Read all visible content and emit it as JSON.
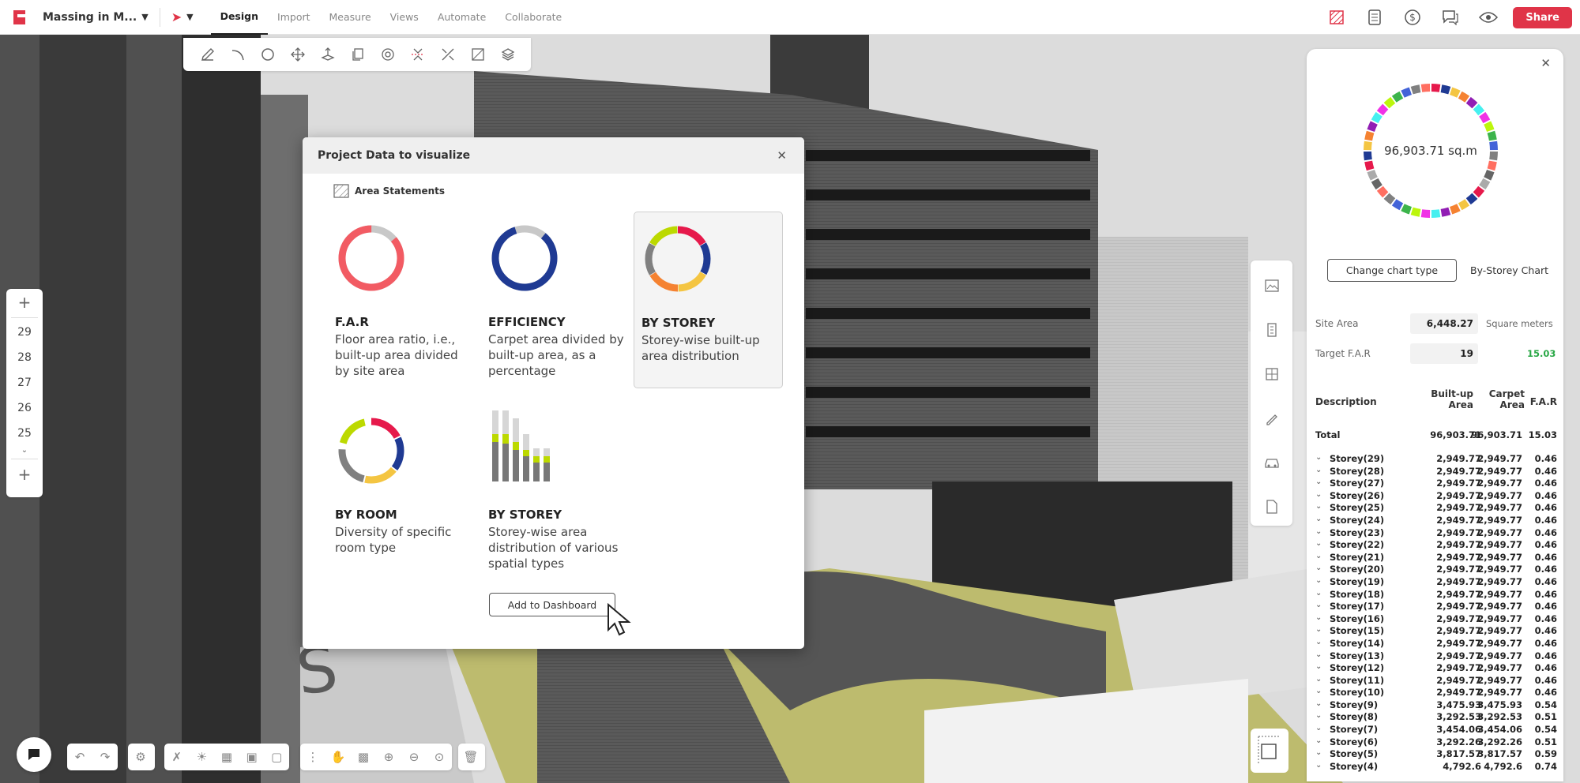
{
  "header": {
    "project_name": "Massing in M...",
    "tabs": [
      {
        "label": "Design",
        "active": true
      },
      {
        "label": "Import"
      },
      {
        "label": "Measure"
      },
      {
        "label": "Views"
      },
      {
        "label": "Automate"
      },
      {
        "label": "Collaborate"
      }
    ],
    "share_label": "Share",
    "icons": [
      "area-plan-icon",
      "calculator-icon",
      "dollar-icon",
      "comment-icon",
      "eye-icon"
    ]
  },
  "toolbar_icons": [
    "pencil-icon",
    "arc-icon",
    "circle-icon",
    "move-icon",
    "extrude-icon",
    "copy-icon",
    "rotate-icon",
    "split-icon",
    "trim-icon",
    "boolean-icon",
    "layers-icon"
  ],
  "storeys": [
    "29",
    "28",
    "27",
    "26",
    "25"
  ],
  "modal": {
    "title": "Project Data to visualize",
    "section": "Area Statements",
    "cards": [
      {
        "title": "F.A.R",
        "desc": "Floor area ratio, i.e., built-up area divided by site area"
      },
      {
        "title": "EFFICIENCY",
        "desc": "Carpet area divided by built-up area, as a percentage"
      },
      {
        "title": "BY STOREY",
        "desc": "Storey-wise built-up area distribution"
      },
      {
        "title": "BY ROOM",
        "desc": "Diversity of specific room type"
      },
      {
        "title": "BY STOREY",
        "desc": "Storey-wise area distribution of various spatial types"
      }
    ],
    "add_label": "Add to Dashboard"
  },
  "panel": {
    "total_label": "96,903.71 sq.m",
    "change_chart": "Change chart type",
    "chart_name": "By-Storey Chart",
    "site_area_label": "Site Area",
    "site_area_value": "6,448.27",
    "site_area_unit": "Square meters",
    "target_far_label": "Target F.A.R",
    "target_far_value": "19",
    "target_far_actual": "15.03",
    "col_desc": "Description",
    "col_built": "Built-up Area",
    "col_carpet": "Carpet Area",
    "col_far": "F.A.R",
    "total": {
      "label": "Total",
      "built": "96,903.71",
      "carpet": "96,903.71",
      "far": "15.03"
    },
    "rows": [
      {
        "label": "Storey(29)",
        "built": "2,949.77",
        "carpet": "2,949.77",
        "far": "0.46"
      },
      {
        "label": "Storey(28)",
        "built": "2,949.77",
        "carpet": "2,949.77",
        "far": "0.46"
      },
      {
        "label": "Storey(27)",
        "built": "2,949.77",
        "carpet": "2,949.77",
        "far": "0.46"
      },
      {
        "label": "Storey(26)",
        "built": "2,949.77",
        "carpet": "2,949.77",
        "far": "0.46"
      },
      {
        "label": "Storey(25)",
        "built": "2,949.77",
        "carpet": "2,949.77",
        "far": "0.46"
      },
      {
        "label": "Storey(24)",
        "built": "2,949.77",
        "carpet": "2,949.77",
        "far": "0.46"
      },
      {
        "label": "Storey(23)",
        "built": "2,949.77",
        "carpet": "2,949.77",
        "far": "0.46"
      },
      {
        "label": "Storey(22)",
        "built": "2,949.77",
        "carpet": "2,949.77",
        "far": "0.46"
      },
      {
        "label": "Storey(21)",
        "built": "2,949.77",
        "carpet": "2,949.77",
        "far": "0.46"
      },
      {
        "label": "Storey(20)",
        "built": "2,949.77",
        "carpet": "2,949.77",
        "far": "0.46"
      },
      {
        "label": "Storey(19)",
        "built": "2,949.77",
        "carpet": "2,949.77",
        "far": "0.46"
      },
      {
        "label": "Storey(18)",
        "built": "2,949.77",
        "carpet": "2,949.77",
        "far": "0.46"
      },
      {
        "label": "Storey(17)",
        "built": "2,949.77",
        "carpet": "2,949.77",
        "far": "0.46"
      },
      {
        "label": "Storey(16)",
        "built": "2,949.77",
        "carpet": "2,949.77",
        "far": "0.46"
      },
      {
        "label": "Storey(15)",
        "built": "2,949.77",
        "carpet": "2,949.77",
        "far": "0.46"
      },
      {
        "label": "Storey(14)",
        "built": "2,949.77",
        "carpet": "2,949.77",
        "far": "0.46"
      },
      {
        "label": "Storey(13)",
        "built": "2,949.77",
        "carpet": "2,949.77",
        "far": "0.46"
      },
      {
        "label": "Storey(12)",
        "built": "2,949.77",
        "carpet": "2,949.77",
        "far": "0.46"
      },
      {
        "label": "Storey(11)",
        "built": "2,949.77",
        "carpet": "2,949.77",
        "far": "0.46"
      },
      {
        "label": "Storey(10)",
        "built": "2,949.77",
        "carpet": "2,949.77",
        "far": "0.46"
      },
      {
        "label": "Storey(9)",
        "built": "3,475.93",
        "carpet": "3,475.93",
        "far": "0.54"
      },
      {
        "label": "Storey(8)",
        "built": "3,292.53",
        "carpet": "3,292.53",
        "far": "0.51"
      },
      {
        "label": "Storey(7)",
        "built": "3,454.06",
        "carpet": "3,454.06",
        "far": "0.54"
      },
      {
        "label": "Storey(6)",
        "built": "3,292.26",
        "carpet": "3,292.26",
        "far": "0.51"
      },
      {
        "label": "Storey(5)",
        "built": "3,817.57",
        "carpet": "3,817.57",
        "far": "0.59"
      },
      {
        "label": "Storey(4)",
        "built": "4,792.6",
        "carpet": "4,792.6",
        "far": "0.74"
      }
    ],
    "donut_colors": [
      "#e6194b",
      "#1f3a93",
      "#f4c542",
      "#f58231",
      "#911eb4",
      "#46f0f0",
      "#f032e6",
      "#bcf60c",
      "#3cb44b",
      "#4363d8",
      "#808080",
      "#ff6f61",
      "#666666",
      "#aaaaaa"
    ]
  }
}
